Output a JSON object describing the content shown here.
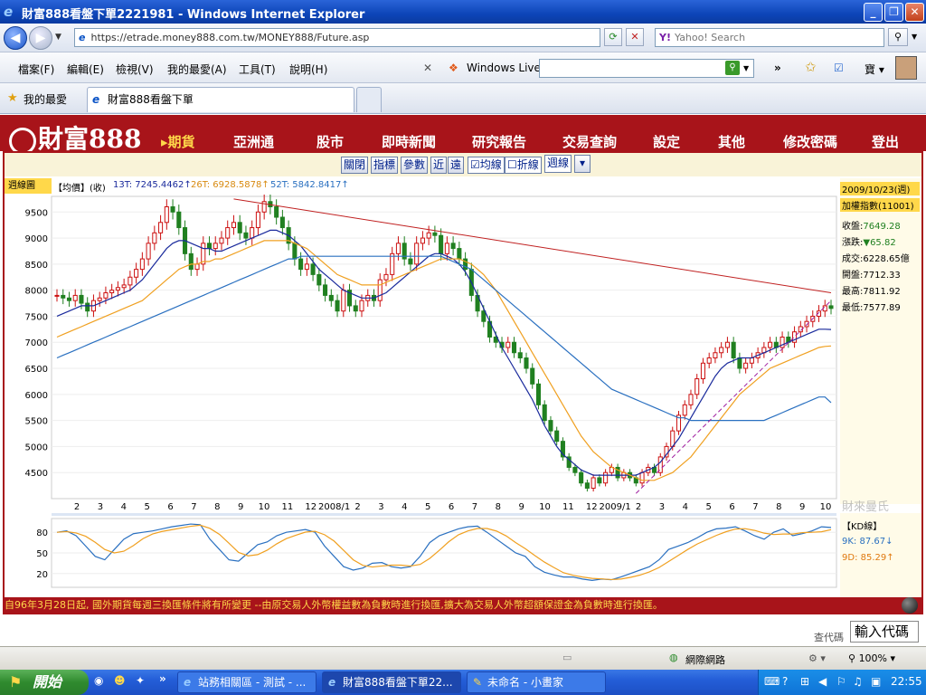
{
  "window": {
    "title": "財富888看盤下單2221981 - Windows Internet Explorer"
  },
  "address": {
    "url": "https://etrade.money888.com.tw/MONEY888/Future.asp",
    "search_placeholder": "Yahoo! Search"
  },
  "menu": [
    "檔案(F)",
    "編輯(E)",
    "檢視(V)",
    "我的最愛(A)",
    "工具(T)",
    "說明(H)"
  ],
  "live": {
    "label": "Windows Live"
  },
  "favorites": {
    "label": "我的最愛",
    "tab": "財富888看盤下單"
  },
  "site": {
    "logo": "財富888",
    "nav": [
      "期貨",
      "亞洲通",
      "股市",
      "即時新聞",
      "研究報告",
      "交易查詢",
      "設定",
      "其他",
      "修改密碼",
      "登出"
    ]
  },
  "toolbar": {
    "buttons": [
      "關閉",
      "指標",
      "參數",
      "近",
      "遠"
    ],
    "ma_check": "均線",
    "line_check": "折線",
    "period": "週線"
  },
  "legend": {
    "label": "週線圖",
    "price": "【均價】(收)",
    "ma13": "13T: 7245.4462↑",
    "ma26": "26T: 6928.5878↑",
    "ma52": "52T: 5842.8417↑"
  },
  "info": {
    "date": "2009/10/23(週)",
    "name": "加權指數(11001)",
    "close_label": "收盤:",
    "close": "7649.28",
    "change_label": "漲跌:",
    "change": "▼65.82",
    "volume_label": "成交:",
    "volume": "6228.65億",
    "open_label": "開盤:",
    "open": "7712.33",
    "high_label": "最高:",
    "high": "7811.92",
    "low_label": "最低:",
    "low": "7577.89"
  },
  "kd": {
    "title": "【KD線】",
    "k": "9K: 87.67↓",
    "d": "9D: 85.29↑"
  },
  "watermark": "財來曼氏",
  "ticker": "自96年3月28日起, 國外期貨每週三換匯條件將有所變更 --由原交易人外幣權益數為負數時進行換匯,擴大為交易人外幣超額保證金為負數時進行換匯。",
  "code": {
    "label": "查代碼",
    "input": "輸入代碼"
  },
  "status": {
    "zone": "網際網路",
    "zoom": "100%"
  },
  "taskbar": {
    "start": "開始",
    "tasks": [
      "站務相關區 - 測試 - ...",
      "財富888看盤下單22...",
      "未命名 - 小畫家"
    ],
    "clock": "22:55"
  },
  "colors": {
    "brand": "#a8141a",
    "ma13": "#1a2a9c",
    "ma26": "#f0a020",
    "ma52": "#2a70c0",
    "up": "#cc1010",
    "down": "#208020"
  },
  "chart_data": {
    "type": "candlestick",
    "title": "",
    "period": "weekly",
    "y_ticks": [
      4500,
      5000,
      5500,
      6000,
      6500,
      7000,
      7500,
      8000,
      8500,
      9000,
      9500
    ],
    "ylim": [
      4000,
      9800
    ],
    "x_labels": [
      "2",
      "3",
      "4",
      "5",
      "6",
      "7",
      "8",
      "9",
      "10",
      "11",
      "12",
      "2008/1",
      "2",
      "3",
      "4",
      "5",
      "6",
      "7",
      "8",
      "9",
      "10",
      "11",
      "12",
      "2009/1",
      "2",
      "3",
      "4",
      "5",
      "6",
      "7",
      "8",
      "9",
      "10"
    ],
    "closes": [
      7900,
      7850,
      7800,
      7900,
      7750,
      7600,
      7800,
      7850,
      7950,
      8000,
      8050,
      8100,
      8250,
      8400,
      8600,
      8900,
      9100,
      9300,
      9600,
      9500,
      9200,
      8700,
      8400,
      8500,
      8900,
      8800,
      8900,
      9000,
      9200,
      9300,
      9100,
      9000,
      9200,
      9500,
      9700,
      9600,
      9400,
      9200,
      8900,
      8600,
      8400,
      8500,
      8300,
      8100,
      7900,
      7800,
      7600,
      8000,
      7700,
      7600,
      7800,
      7900,
      7800,
      8200,
      8300,
      8700,
      8900,
      8600,
      8500,
      8900,
      9000,
      9100,
      9050,
      8700,
      8900,
      8800,
      8600,
      8400,
      7900,
      7600,
      7400,
      7100,
      7000,
      6900,
      7000,
      6800,
      6700,
      6500,
      6200,
      5800,
      5500,
      5300,
      5100,
      4800,
      4600,
      4500,
      4300,
      4200,
      4400,
      4300,
      4500,
      4600,
      4400,
      4500,
      4400,
      4300,
      4500,
      4600,
      4500,
      4800,
      5000,
      5300,
      5600,
      5800,
      6000,
      6300,
      6600,
      6700,
      6800,
      6900,
      7000,
      6700,
      6500,
      6600,
      6700,
      6800,
      6900,
      7000,
      6900,
      7100,
      7000,
      7200,
      7300,
      7400,
      7500,
      7600,
      7700,
      7650
    ],
    "series": [
      {
        "name": "13T",
        "values": [
          7500,
          7550,
          7600,
          7650,
          7700,
          7700,
          7700,
          7750,
          7800,
          7850,
          7900,
          7950,
          8000,
          8100,
          8200,
          8350,
          8500,
          8650,
          8800,
          8900,
          8950,
          8950,
          8900,
          8850,
          8800,
          8800,
          8750,
          8750,
          8800,
          8850,
          8900,
          8950,
          9000,
          9050,
          9100,
          9150,
          9150,
          9100,
          9050,
          8950,
          8850,
          8700,
          8550,
          8400,
          8300,
          8200,
          8100,
          8000,
          7950,
          7900,
          7850,
          7850,
          7850,
          7900,
          7950,
          8050,
          8150,
          8250,
          8350,
          8450,
          8550,
          8650,
          8700,
          8700,
          8650,
          8600,
          8500,
          8350,
          8150,
          7900,
          7650,
          7400,
          7150,
          6900,
          6700,
          6500,
          6300,
          6100,
          5900,
          5650,
          5400,
          5200,
          5000,
          4850,
          4750,
          4650,
          4550,
          4500,
          4450,
          4450,
          4450,
          4450,
          4450,
          4450,
          4450,
          4450,
          4500,
          4550,
          4600,
          4700,
          4850,
          5000,
          5150,
          5350,
          5550,
          5750,
          5950,
          6150,
          6350,
          6500,
          6600,
          6650,
          6700,
          6700,
          6700,
          6750,
          6800,
          6850,
          6900,
          6950,
          7000,
          7050,
          7100,
          7150,
          7200,
          7250,
          7250,
          7245
        ]
      },
      {
        "name": "26T",
        "values": [
          7100,
          7150,
          7200,
          7250,
          7300,
          7350,
          7400,
          7450,
          7500,
          7550,
          7600,
          7650,
          7700,
          7750,
          7800,
          7900,
          8000,
          8100,
          8200,
          8300,
          8400,
          8450,
          8500,
          8500,
          8550,
          8550,
          8600,
          8600,
          8650,
          8700,
          8750,
          8800,
          8850,
          8900,
          8950,
          8950,
          8950,
          8950,
          8950,
          8900,
          8850,
          8800,
          8700,
          8600,
          8500,
          8400,
          8300,
          8250,
          8200,
          8150,
          8100,
          8100,
          8100,
          8100,
          8150,
          8200,
          8250,
          8300,
          8350,
          8400,
          8450,
          8500,
          8550,
          8600,
          8600,
          8600,
          8600,
          8550,
          8500,
          8400,
          8300,
          8150,
          8000,
          7800,
          7600,
          7400,
          7200,
          7000,
          6800,
          6600,
          6400,
          6200,
          6000,
          5800,
          5600,
          5400,
          5200,
          5050,
          4900,
          4800,
          4700,
          4600,
          4550,
          4500,
          4450,
          4400,
          4350,
          4350,
          4350,
          4400,
          4450,
          4500,
          4600,
          4700,
          4800,
          4950,
          5100,
          5250,
          5400,
          5550,
          5700,
          5850,
          6000,
          6100,
          6200,
          6300,
          6400,
          6500,
          6550,
          6600,
          6650,
          6700,
          6750,
          6800,
          6850,
          6900,
          6920,
          6929
        ]
      },
      {
        "name": "52T",
        "values": [
          6700,
          6750,
          6800,
          6850,
          6900,
          6950,
          7000,
          7050,
          7100,
          7150,
          7200,
          7250,
          7300,
          7350,
          7400,
          7450,
          7500,
          7550,
          7600,
          7650,
          7700,
          7750,
          7800,
          7850,
          7900,
          7950,
          8000,
          8050,
          8100,
          8150,
          8200,
          8250,
          8300,
          8350,
          8400,
          8450,
          8500,
          8550,
          8600,
          8600,
          8650,
          8650,
          8650,
          8650,
          8650,
          8650,
          8650,
          8650,
          8650,
          8650,
          8650,
          8650,
          8650,
          8650,
          8650,
          8650,
          8650,
          8650,
          8650,
          8650,
          8650,
          8650,
          8650,
          8650,
          8600,
          8550,
          8500,
          8450,
          8400,
          8300,
          8200,
          8100,
          8000,
          7900,
          7800,
          7700,
          7600,
          7500,
          7400,
          7300,
          7200,
          7100,
          7000,
          6900,
          6800,
          6700,
          6600,
          6500,
          6400,
          6300,
          6200,
          6100,
          6050,
          6000,
          5950,
          5900,
          5850,
          5800,
          5750,
          5700,
          5650,
          5600,
          5550,
          5550,
          5500,
          5500,
          5500,
          5500,
          5500,
          5500,
          5500,
          5500,
          5500,
          5500,
          5500,
          5500,
          5500,
          5550,
          5600,
          5650,
          5700,
          5750,
          5800,
          5850,
          5900,
          5950,
          5950,
          5843
        ]
      }
    ],
    "kd": {
      "k": [
        80,
        82,
        75,
        60,
        45,
        40,
        55,
        70,
        78,
        80,
        82,
        85,
        88,
        90,
        92,
        91,
        70,
        55,
        40,
        38,
        50,
        62,
        66,
        75,
        80,
        82,
        84,
        80,
        60,
        45,
        30,
        25,
        28,
        35,
        36,
        30,
        28,
        30,
        45,
        65,
        75,
        80,
        85,
        88,
        89,
        80,
        70,
        60,
        50,
        45,
        30,
        22,
        18,
        15,
        15,
        12,
        10,
        12,
        11,
        15,
        20,
        25,
        30,
        40,
        55,
        60,
        65,
        72,
        80,
        85,
        86,
        88,
        82,
        75,
        70,
        80,
        85,
        75,
        78,
        82,
        88,
        87
      ]
    }
  }
}
